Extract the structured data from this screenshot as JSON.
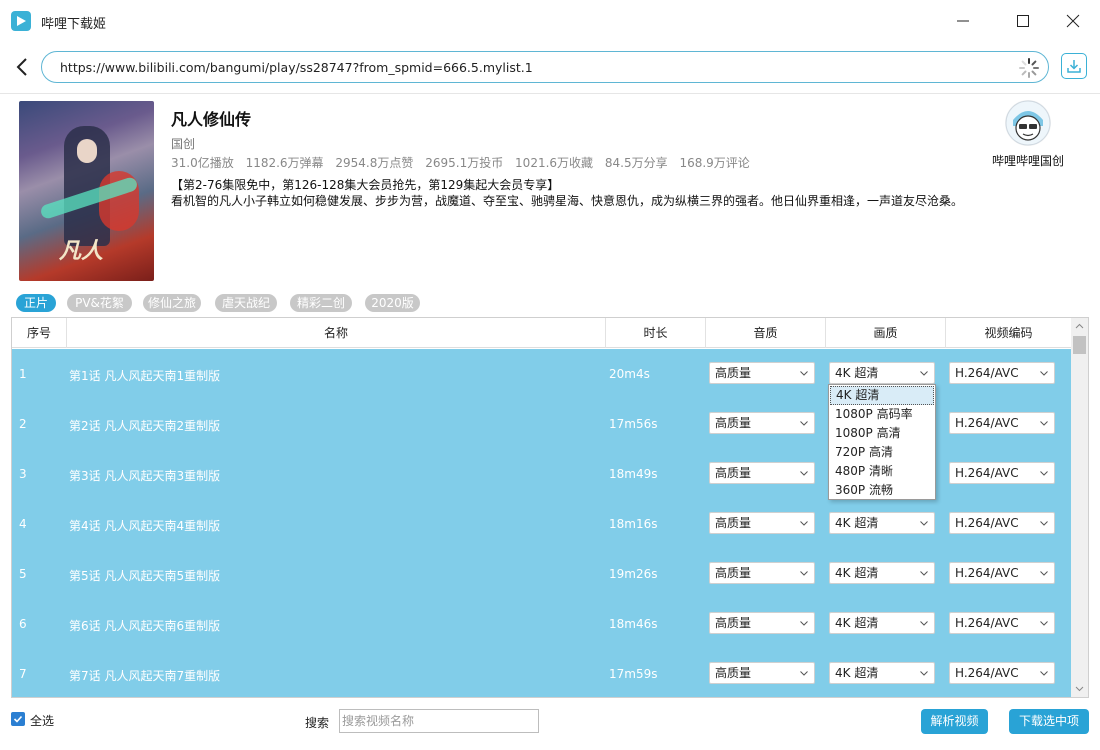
{
  "app": {
    "title": "哔哩下载姬"
  },
  "address": {
    "url": "https://www.bilibili.com/bangumi/play/ss28747?from_spmid=666.5.mylist.1"
  },
  "info": {
    "title": "凡人修仙传",
    "category": "国创",
    "stats": [
      "31.0亿播放",
      "1182.6万弹幕",
      "2954.8万点赞",
      "2695.1万投币",
      "1021.6万收藏",
      "84.5万分享",
      "168.9万评论"
    ],
    "badge": "【第2-76集限免中，第126-128集大会员抢先，第129集起大会员专享】",
    "description": "看机智的凡人小子韩立如何稳健发展、步步为营，战魔道、夺至宝、驰骋星海、快意恩仇，成为纵横三界的强者。他日仙界重相逢，一声道友尽沧桑。",
    "poster_text": "凡人",
    "uploader": "哔哩哔哩国创"
  },
  "tabs": [
    "正片",
    "PV&花絮",
    "修仙之旅",
    "虐天战纪",
    "精彩二创",
    "2020版"
  ],
  "table": {
    "headers": [
      "序号",
      "名称",
      "时长",
      "音质",
      "画质",
      "视频编码"
    ],
    "rows": [
      {
        "index": "1",
        "name": "第1话 凡人风起天南1重制版",
        "duration": "20m4s",
        "audio": "高质量",
        "quality": "4K 超清",
        "codec": "H.264/AVC"
      },
      {
        "index": "2",
        "name": "第2话 凡人风起天南2重制版",
        "duration": "17m56s",
        "audio": "高质量",
        "quality": "4K 超清",
        "codec": "H.264/AVC"
      },
      {
        "index": "3",
        "name": "第3话 凡人风起天南3重制版",
        "duration": "18m49s",
        "audio": "高质量",
        "quality": "4K 超清",
        "codec": "H.264/AVC"
      },
      {
        "index": "4",
        "name": "第4话 凡人风起天南4重制版",
        "duration": "18m16s",
        "audio": "高质量",
        "quality": "4K 超清",
        "codec": "H.264/AVC"
      },
      {
        "index": "5",
        "name": "第5话 凡人风起天南5重制版",
        "duration": "19m26s",
        "audio": "高质量",
        "quality": "4K 超清",
        "codec": "H.264/AVC"
      },
      {
        "index": "6",
        "name": "第6话 凡人风起天南6重制版",
        "duration": "18m46s",
        "audio": "高质量",
        "quality": "4K 超清",
        "codec": "H.264/AVC"
      },
      {
        "index": "7",
        "name": "第7话 凡人风起天南7重制版",
        "duration": "17m59s",
        "audio": "高质量",
        "quality": "4K 超清",
        "codec": "H.264/AVC"
      }
    ]
  },
  "quality_dropdown": {
    "options": [
      "4K 超清",
      "1080P 高码率",
      "1080P 高清",
      "720P 高清",
      "480P 清晰",
      "360P 流畅"
    ],
    "selected": "4K 超清"
  },
  "bottom": {
    "select_all_label": "全选",
    "select_all_checked": true,
    "search_label": "搜索",
    "search_placeholder": "搜索视频名称",
    "parse_button": "解析视频",
    "download_button": "下载选中项"
  },
  "colors": {
    "accent": "#29a3d6",
    "row_background": "#81cde9",
    "tab_inactive": "#c8c8c8"
  }
}
